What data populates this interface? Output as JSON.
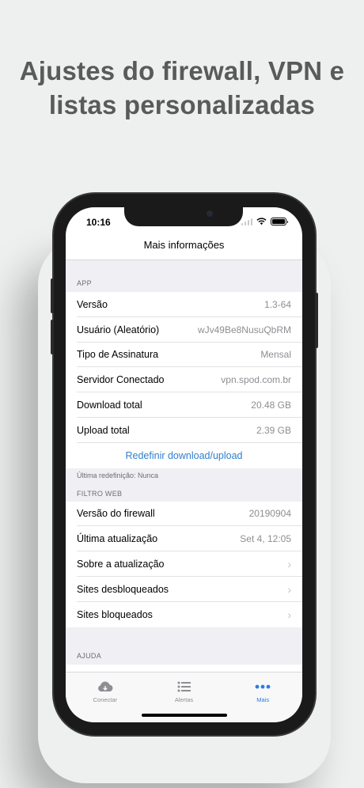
{
  "headline": {
    "line1": "Ajustes do firewall, VPN e",
    "line2": "listas personalizadas"
  },
  "status_bar": {
    "time": "10:16"
  },
  "nav": {
    "title": "Mais informações"
  },
  "app_section": {
    "header": "APP",
    "rows": [
      {
        "label": "Versão",
        "value": "1.3-64"
      },
      {
        "label": "Usuário (Aleatório)",
        "value": "wJv49Be8NusuQbRM"
      },
      {
        "label": "Tipo de Assinatura",
        "value": "Mensal"
      },
      {
        "label": "Servidor Conectado",
        "value": "vpn.spod.com.br"
      },
      {
        "label": "Download total",
        "value": "20.48 GB"
      },
      {
        "label": "Upload total",
        "value": "2.39 GB"
      }
    ],
    "reset_action": "Redefinir download/upload",
    "footer": "Última redefinição: Nunca"
  },
  "web_filter_section": {
    "header": "FILTRO WEB",
    "rows": [
      {
        "label": "Versão do firewall",
        "value": "20190904"
      },
      {
        "label": "Última atualização",
        "value": "Set 4, 12:05"
      },
      {
        "label": "Sobre a atualização"
      },
      {
        "label": "Sites desbloqueados"
      },
      {
        "label": "Sites bloqueados"
      }
    ]
  },
  "help_section": {
    "header": "AJUDA"
  },
  "tabbar": {
    "tabs": [
      {
        "label": "Conectar",
        "icon": "cloud-icon"
      },
      {
        "label": "Alertas",
        "icon": "list-icon"
      },
      {
        "label": "Mais",
        "icon": "more-dots-icon"
      }
    ],
    "active_color": "#2a7de1"
  },
  "colors": {
    "accent": "#2f7fcf",
    "headline": "#5a5a5a"
  }
}
